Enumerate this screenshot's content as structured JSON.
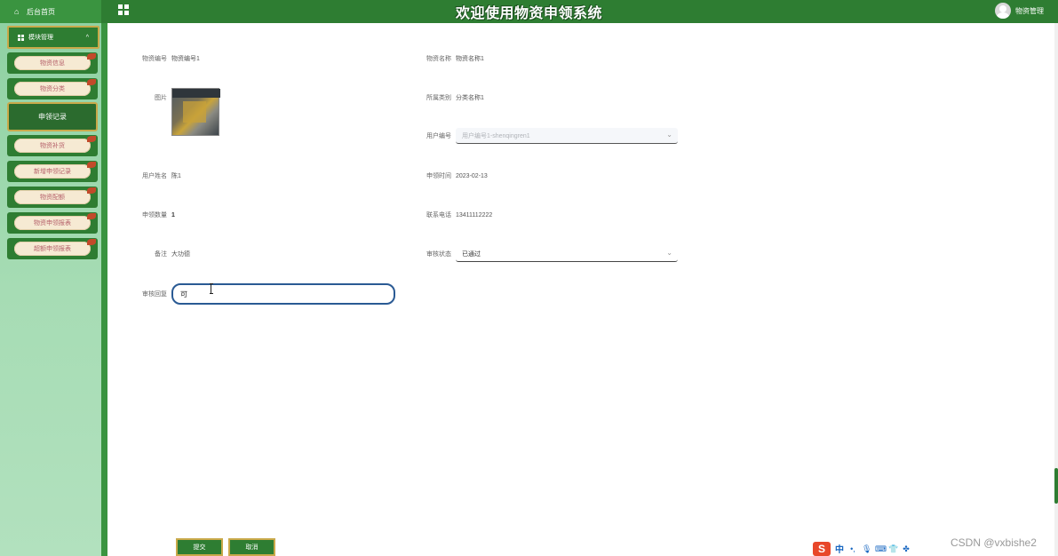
{
  "header": {
    "home_label": "后台首页",
    "system_title": "欢迎使用物资申领系统",
    "user_name": "物资管理"
  },
  "sidebar": {
    "group_label": "模块管理",
    "items": [
      {
        "label": "物资信息"
      },
      {
        "label": "物资分类"
      },
      {
        "label": "申领记录",
        "active": true
      },
      {
        "label": "物资补货"
      },
      {
        "label": "新增申领记录"
      },
      {
        "label": "物资配额"
      },
      {
        "label": "物资申领报表"
      },
      {
        "label": "超额申领报表"
      }
    ]
  },
  "form": {
    "item_no": {
      "label": "物资编号",
      "value": "物资编号1"
    },
    "item_name": {
      "label": "物资名称",
      "value": "物资名称1"
    },
    "image": {
      "label": "图片"
    },
    "category": {
      "label": "所属类别",
      "value": "分类名称1"
    },
    "user_id": {
      "label": "用户编号",
      "value": "用户编号1-shenqingren1"
    },
    "user_name": {
      "label": "用户姓名",
      "value": "陈1"
    },
    "apply_time": {
      "label": "申领时间",
      "value": "2023-02-13"
    },
    "quantity": {
      "label": "申领数量",
      "value": "1"
    },
    "phone": {
      "label": "联系电话",
      "value": "13411112222"
    },
    "remark": {
      "label": "备注",
      "value": "大功德"
    },
    "review_status": {
      "label": "审核状态",
      "value": "已通过"
    },
    "review_reply": {
      "label": "审核回复",
      "value": "可"
    }
  },
  "buttons": {
    "submit": "提交",
    "cancel": "取消"
  },
  "ime": {
    "logo": "S",
    "mode": "中"
  },
  "watermark": "CSDN @vxbishe2",
  "colors": {
    "primary_green": "#2e7d32",
    "gold_border": "#c9a94a",
    "sidebar_bg": "#a6dcb4",
    "input_focus": "#2a5a94"
  }
}
